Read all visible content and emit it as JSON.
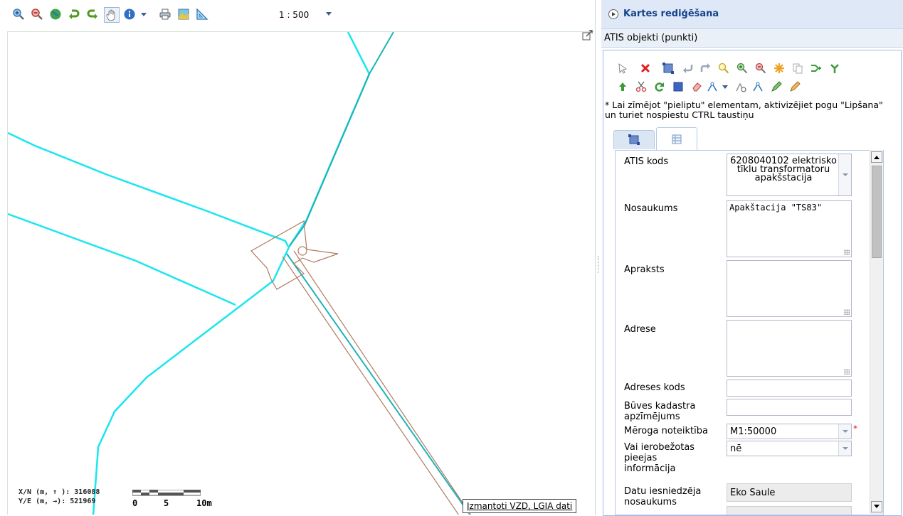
{
  "map": {
    "scale_label": "1 : 500",
    "coords": {
      "xn_label": "X/N (m, ↑ ):",
      "xn_value": "316088",
      "ye_label": "Y/E (m, →):",
      "ye_value": "521969"
    },
    "scalebar": {
      "labels": [
        "0",
        "5",
        "10m"
      ]
    },
    "attribution": "Izmantoti VZD, LGIA dati",
    "toolbar_icons": [
      "zoom-in-icon",
      "zoom-out-icon",
      "full-extent-icon",
      "back-icon",
      "forward-icon",
      "pan-icon",
      "info-icon",
      "dropdown-icon",
      "print-icon",
      "map-export-icon",
      "measure-icon"
    ],
    "colors": {
      "line_cyan": "#19e6f0",
      "line_teal": "#1fb3b8",
      "polygon_brown": "#b07a62"
    }
  },
  "panel": {
    "title": "Kartes rediģēšana",
    "subtitle": "ATIS objekti (punkti)",
    "hint": "* Lai zīmējot \"pieliptu\" elementam, aktivizējiet pogu \"Lipšana\" un turiet nospiestu CTRL taustiņu",
    "tabs": [
      "geometry-tab",
      "attributes-tab"
    ],
    "form": {
      "atis_kods": {
        "label": "ATIS kods",
        "value": "6208040102 elektrisko tīklu transformatoru apakšstacija"
      },
      "nosaukums": {
        "label": "Nosaukums",
        "value": "Apakštacija \"TS83\""
      },
      "apraksts": {
        "label": "Apraksts",
        "value": ""
      },
      "adrese": {
        "label": "Adrese",
        "value": ""
      },
      "adreses_kods": {
        "label": "Adreses kods",
        "value": ""
      },
      "buves_kadastra": {
        "label": "Būves kadastra apzīmējums",
        "value": ""
      },
      "meroga": {
        "label": "Mēroga noteiktība",
        "value": "M1:50000",
        "required_mark": "*"
      },
      "ierobezotas": {
        "label": "Vai ierobežotas pieejas informācija",
        "value": "nē"
      },
      "datu_iesniedzeja": {
        "label": "Datu iesniedzēja nosaukums",
        "value": "Eko Saule"
      }
    }
  }
}
